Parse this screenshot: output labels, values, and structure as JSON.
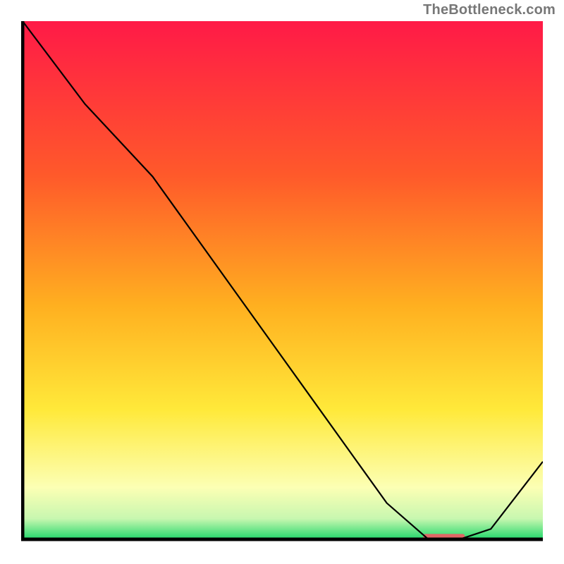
{
  "watermark": "TheBottleneck.com",
  "chart_data": {
    "type": "line",
    "title": "",
    "xlabel": "",
    "ylabel": "",
    "xlim": [
      0,
      100
    ],
    "ylim": [
      0,
      100
    ],
    "categories": [],
    "x": [
      0,
      12,
      25,
      40,
      55,
      70,
      78,
      84,
      90,
      100
    ],
    "values": [
      100,
      84,
      70,
      49,
      28,
      7,
      0,
      0,
      2,
      15
    ],
    "series": [
      {
        "name": "bottleneck-curve",
        "x": [
          0,
          12,
          25,
          40,
          55,
          70,
          78,
          84,
          90,
          100
        ],
        "y": [
          100,
          84,
          70,
          49,
          28,
          7,
          0,
          0,
          2,
          15
        ]
      }
    ],
    "gradient_stops": [
      {
        "offset": 0,
        "color": "#ff1a47"
      },
      {
        "offset": 30,
        "color": "#ff5a2a"
      },
      {
        "offset": 55,
        "color": "#ffb020"
      },
      {
        "offset": 75,
        "color": "#ffe93a"
      },
      {
        "offset": 90,
        "color": "#fcffb4"
      },
      {
        "offset": 96,
        "color": "#c8f7b0"
      },
      {
        "offset": 100,
        "color": "#22d86b"
      }
    ],
    "marker": {
      "x_start": 77,
      "x_end": 85,
      "y": 0.5,
      "color": "#e06666"
    },
    "axes_color": "#000000",
    "line_color": "#000000",
    "line_width": 2.2
  }
}
